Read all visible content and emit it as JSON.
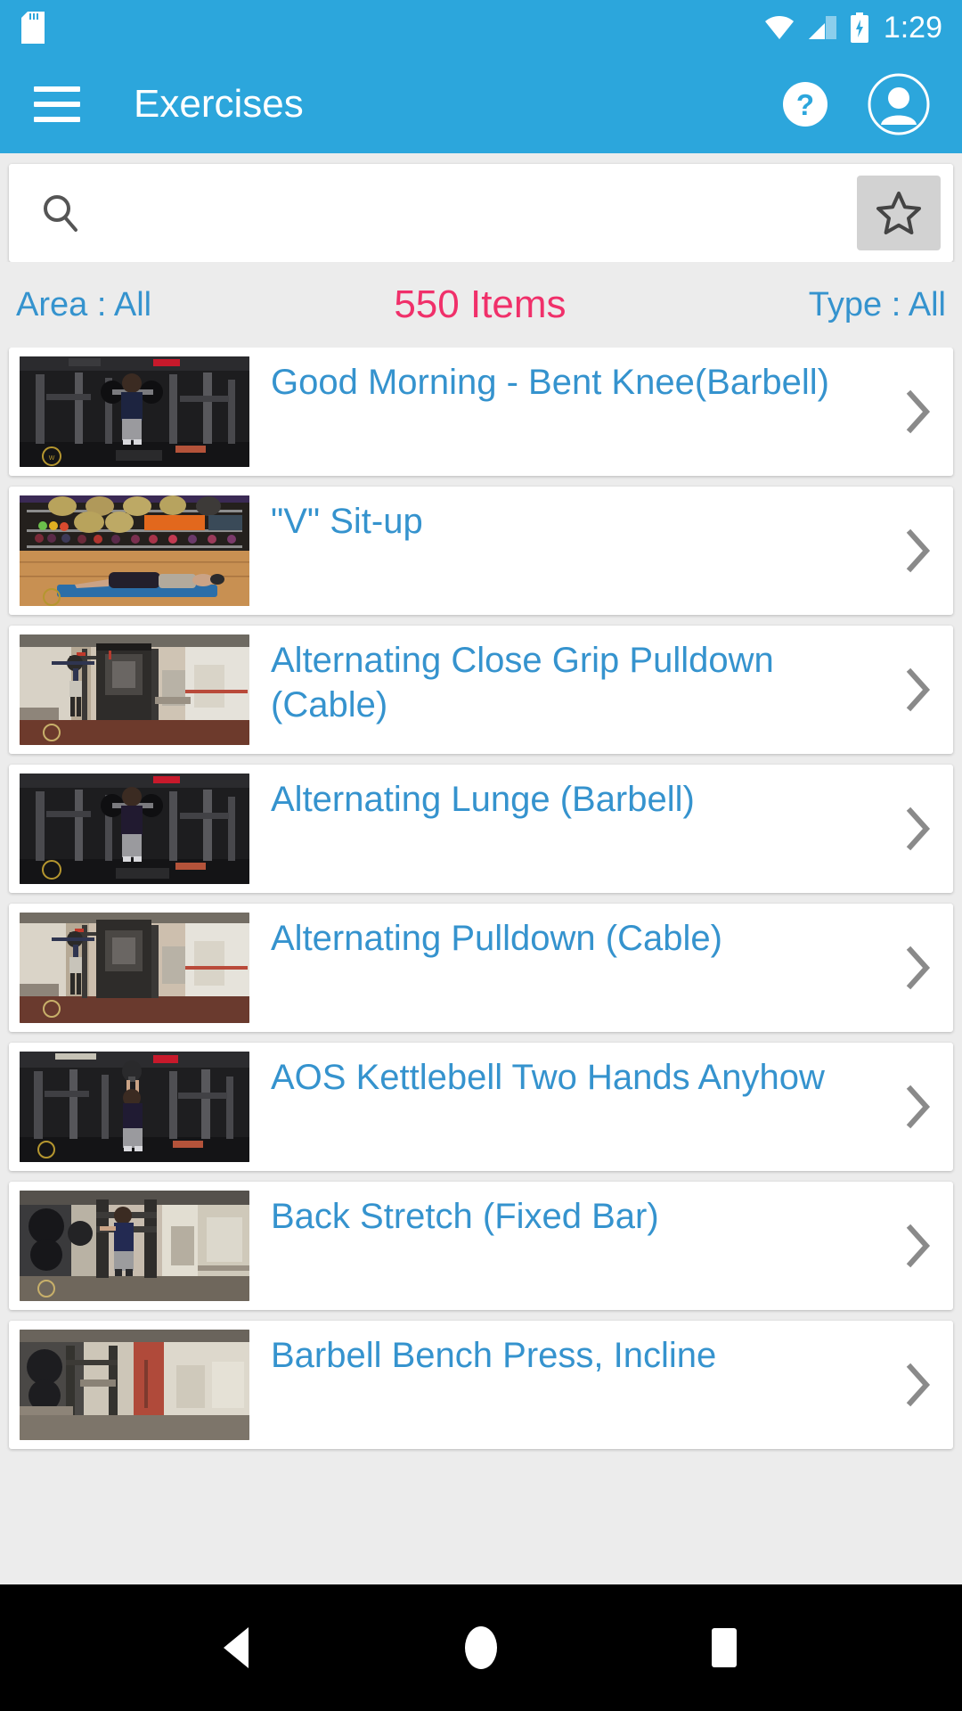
{
  "status_bar": {
    "time": "1:29",
    "icons": [
      "sdcard-icon",
      "wifi-icon",
      "signal-icon",
      "battery-charging-icon"
    ]
  },
  "app_bar": {
    "menu_icon": "hamburger-menu-icon",
    "title": "Exercises",
    "help_icon": "help-icon",
    "profile_icon": "profile-avatar-icon",
    "background_color": "#2CA6DC"
  },
  "search": {
    "placeholder": "",
    "value": "",
    "search_icon": "search-icon",
    "favorite_icon": "star-outline-icon"
  },
  "filters": {
    "area_label": "Area : All",
    "count_label": "550 Items",
    "type_label": "Type : All",
    "link_color": "#3593CE",
    "count_color": "#F0306A"
  },
  "list": {
    "items": [
      {
        "title": "  Good Morning - Bent Knee(Barbell)",
        "thumb": "gym-barbell-front-squat",
        "chevron": "chevron-right-icon"
      },
      {
        "title": "\"V\" Sit-up",
        "thumb": "gym-floor-exercise-balls",
        "chevron": "chevron-right-icon"
      },
      {
        "title": "Alternating Close Grip Pulldown (Cable)",
        "thumb": "gym-cable-machine-bright",
        "chevron": "chevron-right-icon"
      },
      {
        "title": "Alternating Lunge (Barbell)",
        "thumb": "gym-barbell-front-squat",
        "chevron": "chevron-right-icon"
      },
      {
        "title": "Alternating Pulldown (Cable)",
        "thumb": "gym-cable-machine-bright",
        "chevron": "chevron-right-icon"
      },
      {
        "title": "AOS Kettlebell Two Hands Anyhow",
        "thumb": "gym-kettlebell-overhead",
        "chevron": "chevron-right-icon"
      },
      {
        "title": "Back Stretch (Fixed Bar)",
        "thumb": "gym-fixed-bar-stretch",
        "chevron": "chevron-right-icon"
      },
      {
        "title": "Barbell Bench Press, Incline",
        "thumb": "gym-incline-bench",
        "chevron": "chevron-right-icon"
      }
    ]
  },
  "nav_bar": {
    "back_label": "back-button",
    "home_label": "home-button",
    "recents_label": "recents-button"
  }
}
